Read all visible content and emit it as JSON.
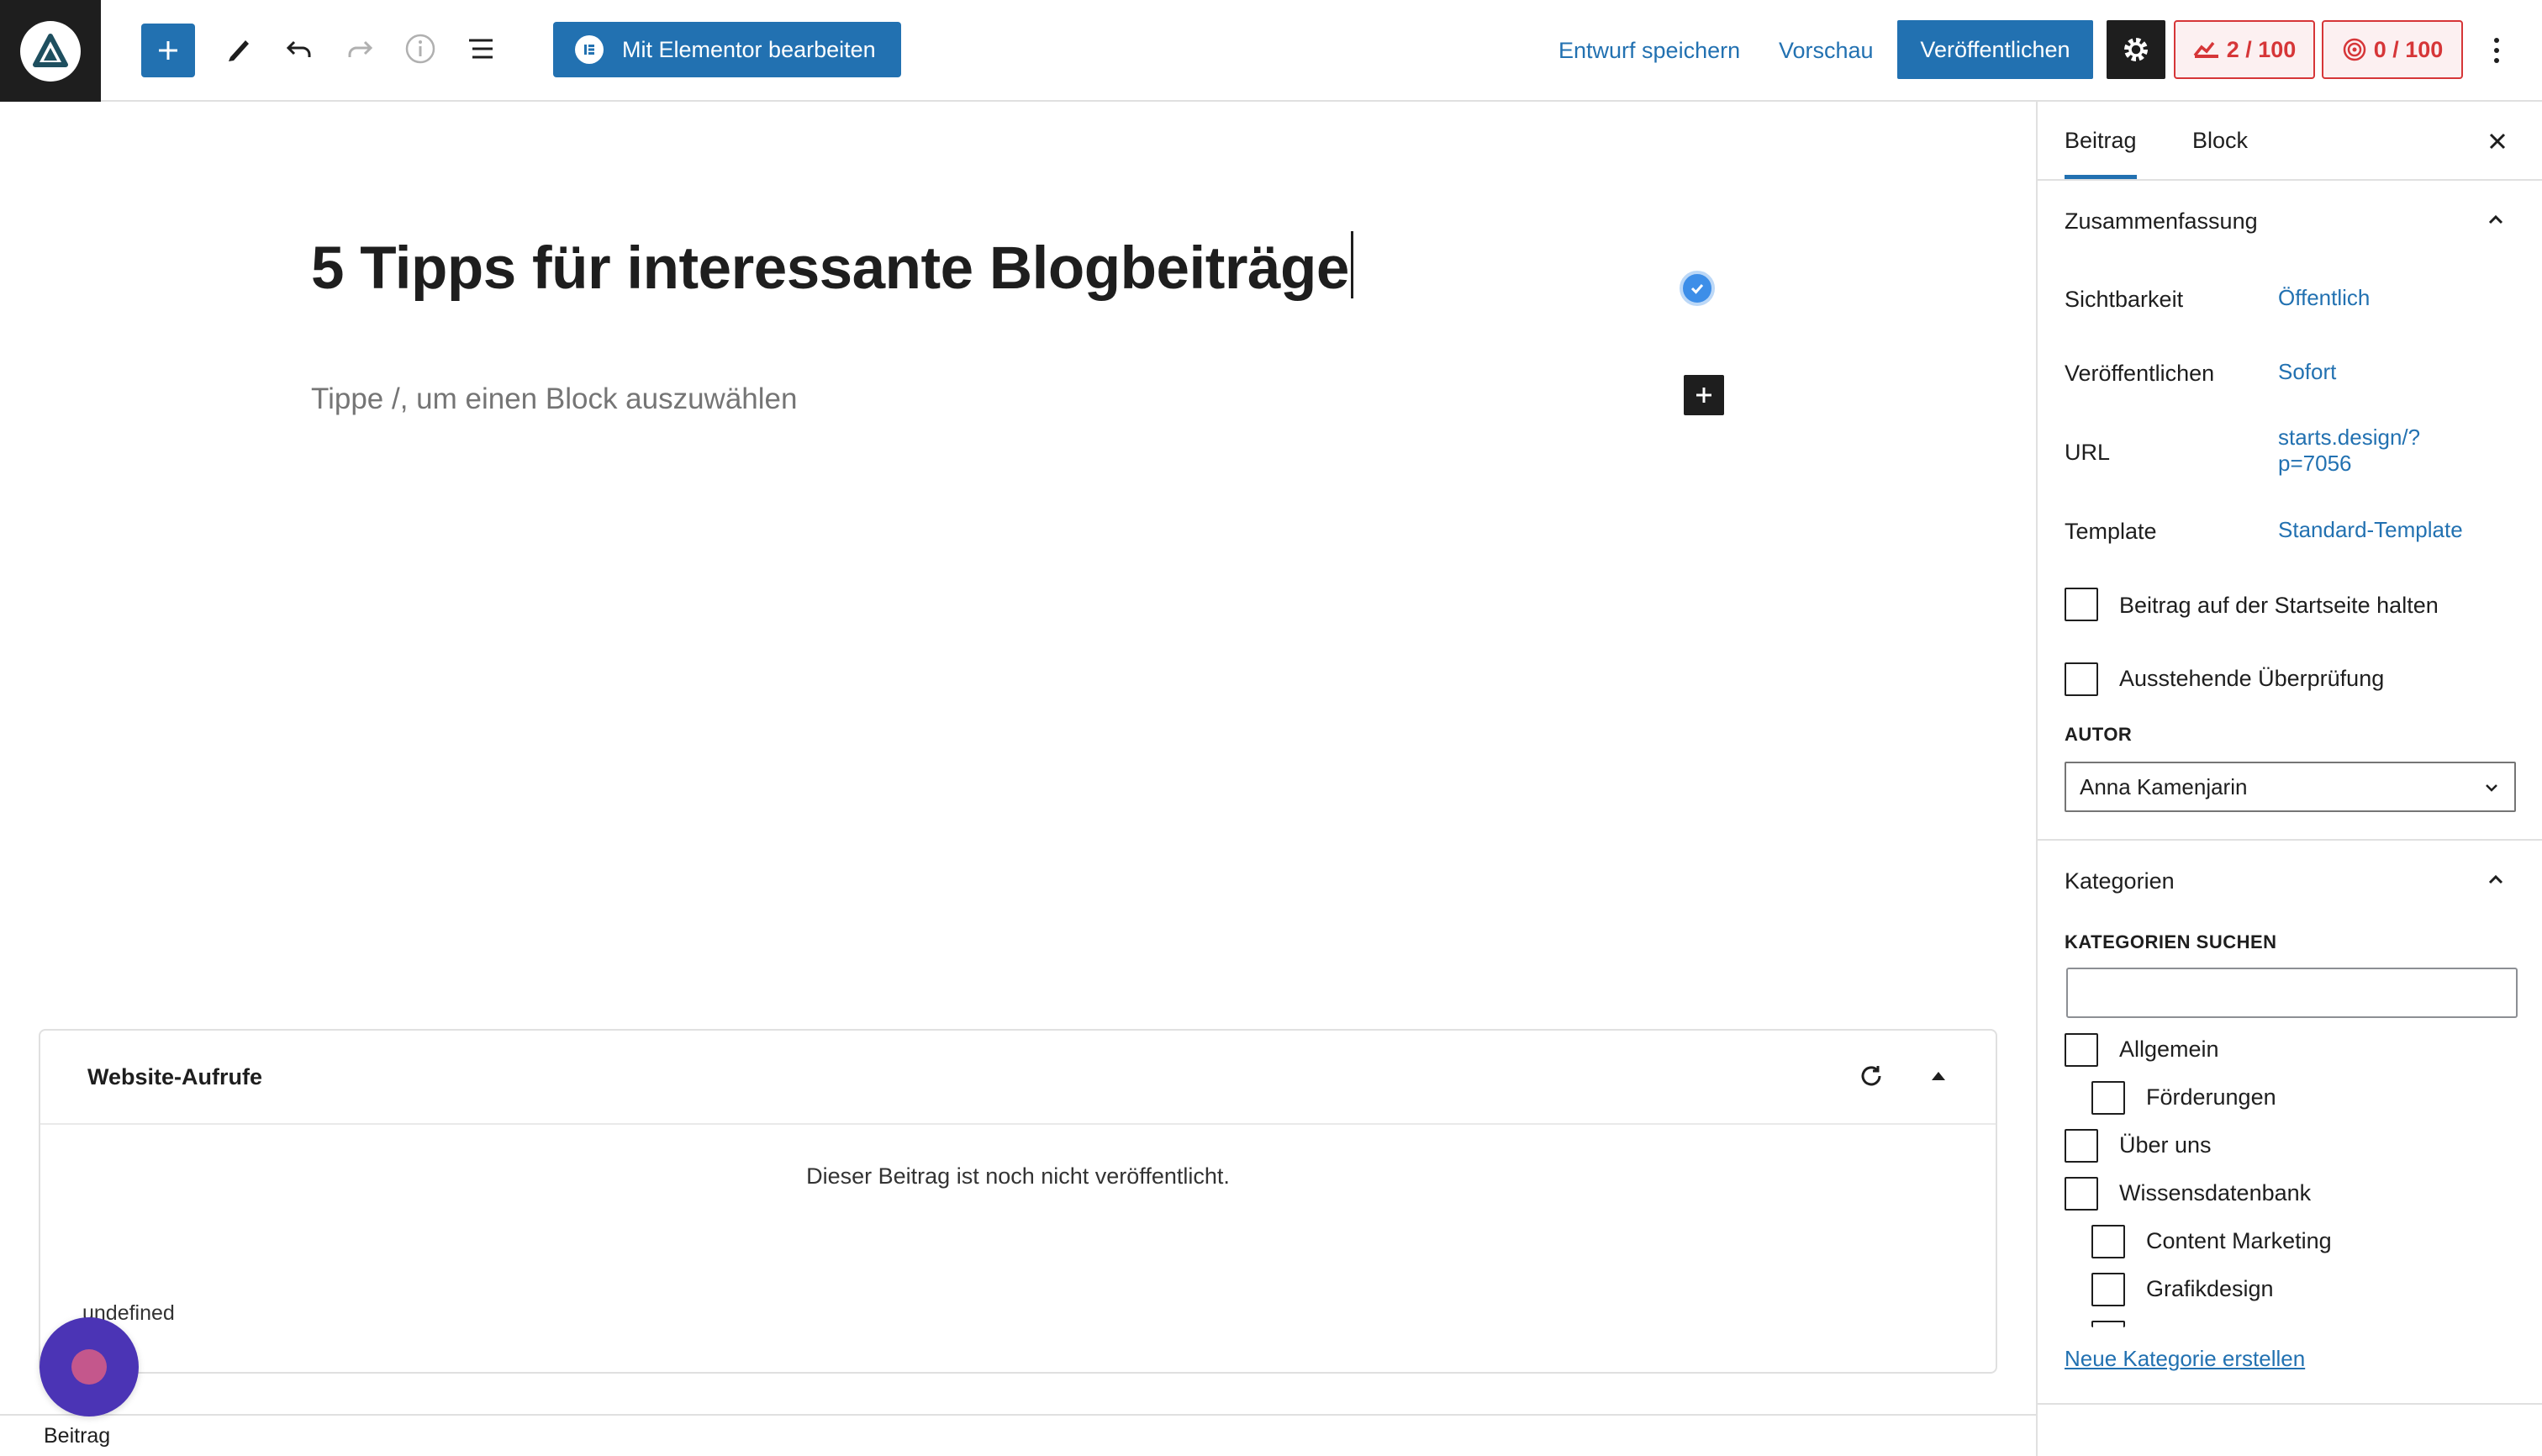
{
  "toolbar": {
    "elementor_label": "Mit Elementor bearbeiten",
    "save_draft_label": "Entwurf speichern",
    "preview_label": "Vorschau",
    "publish_label": "Veröffentlichen",
    "score_1": "2 / 100",
    "score_2": "0 / 100",
    "accent_color": "#2271b1",
    "score_color": "#d63638"
  },
  "editor": {
    "title": "5 Tipps für interessante Blogbeiträge",
    "block_placeholder": "Tippe /, um einen Block auszuwählen"
  },
  "metabox": {
    "title": "Website-Aufrufe",
    "message": "Dieser Beitrag ist noch nicht veröffentlicht.",
    "footer_text": "undefined"
  },
  "bottombar": {
    "breadcrumb": "Beitrag"
  },
  "sidebar": {
    "tabs": [
      {
        "label": "Beitrag",
        "active": true
      },
      {
        "label": "Block",
        "active": false
      }
    ],
    "summary": {
      "heading": "Zusammenfassung",
      "rows": [
        {
          "label": "Sichtbarkeit",
          "value": "Öffentlich"
        },
        {
          "label": "Veröffentlichen",
          "value": "Sofort"
        },
        {
          "label": "URL",
          "value_line1": "starts.design/?",
          "value_line2": "p=7056"
        },
        {
          "label": "Template",
          "value": "Standard-Template"
        }
      ],
      "sticky_label": "Beitrag auf der Startseite halten",
      "pending_label": "Ausstehende Überprüfung",
      "author_label": "AUTOR",
      "author_value": "Anna Kamenjarin"
    },
    "categories": {
      "heading": "Kategorien",
      "search_label": "KATEGORIEN SUCHEN",
      "items": [
        {
          "label": "Allgemein",
          "checked": false,
          "child": false
        },
        {
          "label": "Förderungen",
          "checked": false,
          "child": true
        },
        {
          "label": "Über uns",
          "checked": false,
          "child": false
        },
        {
          "label": "Wissensdatenbank",
          "checked": false,
          "child": false
        },
        {
          "label": "Content Marketing",
          "checked": false,
          "child": true
        },
        {
          "label": "Grafikdesign",
          "checked": false,
          "child": true
        }
      ],
      "new_category_link": "Neue Kategorie erstellen"
    }
  },
  "icons": [
    "site-logo-icon",
    "plus-icon",
    "pencil-icon",
    "undo-icon",
    "redo-icon",
    "info-icon",
    "list-view-icon",
    "elementor-icon",
    "gear-icon",
    "seo-score-icon",
    "readability-icon",
    "kebab-icon",
    "checkmark-icon",
    "close-icon",
    "chevron-up-icon",
    "chevron-down-icon",
    "refresh-icon",
    "triangle-up-icon"
  ]
}
